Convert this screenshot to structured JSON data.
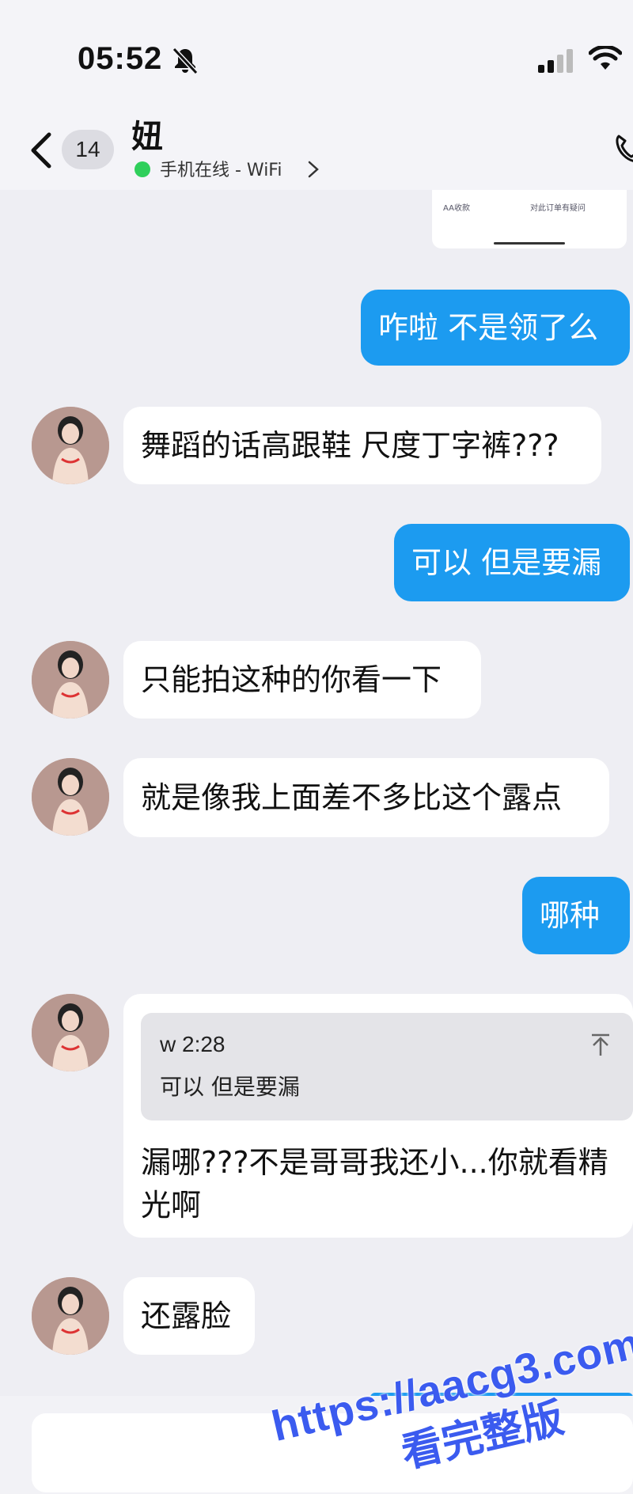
{
  "status_bar": {
    "time": "05:52",
    "icons": [
      "bell-mute-icon",
      "signal-icon",
      "wifi-icon"
    ]
  },
  "header": {
    "unread_count": "14",
    "contact_name": "妞",
    "online_status": "手机在线 - WiFi",
    "icons": [
      "back-icon",
      "chevron-right-icon",
      "phone-icon"
    ]
  },
  "order_card": {
    "option_left": "AA收款",
    "option_right": "对此订单有疑问"
  },
  "messages": [
    {
      "side": "out",
      "text": "咋啦 不是领了么"
    },
    {
      "side": "in",
      "text": "舞蹈的话高跟鞋 尺度丁字裤???"
    },
    {
      "side": "out",
      "text": "可以 但是要漏"
    },
    {
      "side": "in",
      "text": "只能拍这种的你看一下"
    },
    {
      "side": "in",
      "text": "就是像我上面差不多比这个露点"
    },
    {
      "side": "out",
      "text": "哪种"
    },
    {
      "side": "in",
      "quote": {
        "time": "w 2:28",
        "text": "可以 但是要漏"
      },
      "text_line1": "漏哪???不是哥哥我还小...你就看精",
      "text_line2": "光啊"
    },
    {
      "side": "in",
      "text": "还露脸"
    }
  ],
  "watermark": {
    "url": "https://aacg3.com",
    "caption": "看完整版"
  },
  "colors": {
    "outgoing_bubble": "#1c9bf0",
    "incoming_bubble": "#ffffff",
    "background": "#eeeef3",
    "online_dot": "#2fcf5b",
    "watermark": "#3b5bef"
  }
}
